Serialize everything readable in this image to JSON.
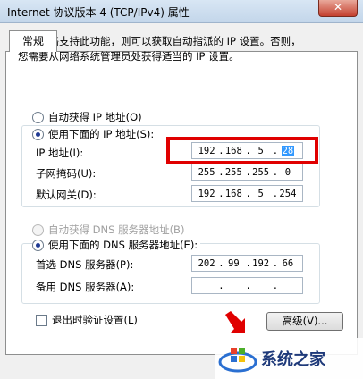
{
  "window": {
    "title": "Internet 协议版本 4 (TCP/IPv4) 属性",
    "close_label": "✕"
  },
  "tab": {
    "label": "常规"
  },
  "description": {
    "line1": "如果网络支持此功能，则可以获取自动指派的 IP 设置。否则，",
    "line2": "您需要从网络系统管理员处获得适当的 IP 设置。"
  },
  "ip_section": {
    "auto_label": "自动获得 IP 地址(O)",
    "manual_label": "使用下面的 IP 地址(S):",
    "selected": "manual",
    "fields": [
      {
        "label": "IP 地址(I):",
        "octets": [
          "192",
          "168",
          "5",
          "28"
        ],
        "selected_octet": 3
      },
      {
        "label": "子网掩码(U):",
        "octets": [
          "255",
          "255",
          "255",
          "0"
        ]
      },
      {
        "label": "默认网关(D):",
        "octets": [
          "192",
          "168",
          "5",
          "254"
        ]
      }
    ]
  },
  "dns_section": {
    "auto_label": "自动获得 DNS 服务器地址(B)",
    "manual_label": "使用下面的 DNS 服务器地址(E):",
    "selected": "manual",
    "fields": [
      {
        "label": "首选 DNS 服务器(P):",
        "octets": [
          "202",
          "99",
          "192",
          "66"
        ]
      },
      {
        "label": "备用 DNS 服务器(A):",
        "octets": [
          "",
          "",
          "",
          ""
        ]
      }
    ]
  },
  "validate_checkbox": {
    "label": "退出时验证设置(L)",
    "checked": false
  },
  "advanced_button": {
    "label": "高级(V)..."
  },
  "watermark": {
    "text": "系统之家"
  },
  "colors": {
    "highlight": "#e00000",
    "selection": "#3399ff"
  }
}
